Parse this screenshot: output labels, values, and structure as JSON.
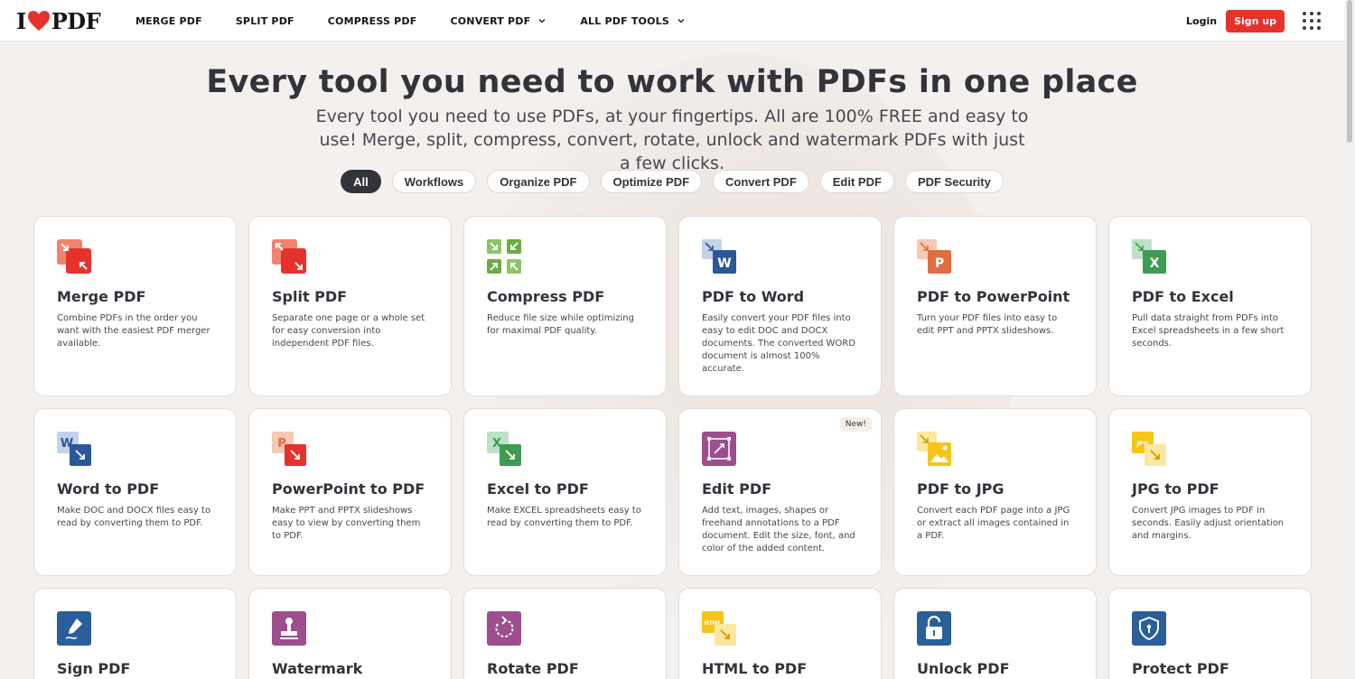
{
  "header": {
    "logo_prefix": "I",
    "logo_suffix": "PDF",
    "nav": [
      "MERGE PDF",
      "SPLIT PDF",
      "COMPRESS PDF",
      "CONVERT PDF",
      "ALL PDF TOOLS"
    ],
    "login": "Login",
    "signup": "Sign up"
  },
  "hero": {
    "title": "Every tool you need to work with PDFs in one place",
    "subtitle": "Every tool you need to use PDFs, at your fingertips. All are 100% FREE and easy to use! Merge, split, compress, convert, rotate, unlock and watermark PDFs with just a few clicks."
  },
  "filters": [
    "All",
    "Workflows",
    "Organize PDF",
    "Optimize PDF",
    "Convert PDF",
    "Edit PDF",
    "PDF Security"
  ],
  "colors": {
    "brand_red": "#e5322d",
    "organize": "#e5322d",
    "optimize": "#6bac45",
    "word": "#2b579a",
    "powerpoint": "#e06d3f",
    "excel": "#3e9b52",
    "edit": "#9c4e8e",
    "jpg": "#f5c518",
    "security": "#2b5f9a"
  },
  "tools": [
    {
      "title": "Merge PDF",
      "desc": "Combine PDFs in the order you want with the easiest PDF merger available.",
      "icon": "merge-icon"
    },
    {
      "title": "Split PDF",
      "desc": "Separate one page or a whole set for easy conversion into independent PDF files.",
      "icon": "split-icon"
    },
    {
      "title": "Compress PDF",
      "desc": "Reduce file size while optimizing for maximal PDF quality.",
      "icon": "compress-icon"
    },
    {
      "title": "PDF to Word",
      "desc": "Easily convert your PDF files into easy to edit DOC and DOCX documents. The converted WORD document is almost 100% accurate.",
      "icon": "pdf-to-word-icon",
      "letter": "W"
    },
    {
      "title": "PDF to PowerPoint",
      "desc": "Turn your PDF files into easy to edit PPT and PPTX slideshows.",
      "icon": "pdf-to-powerpoint-icon",
      "letter": "P"
    },
    {
      "title": "PDF to Excel",
      "desc": "Pull data straight from PDFs into Excel spreadsheets in a few short seconds.",
      "icon": "pdf-to-excel-icon",
      "letter": "X"
    },
    {
      "title": "Word to PDF",
      "desc": "Make DOC and DOCX files easy to read by converting them to PDF.",
      "icon": "word-to-pdf-icon",
      "letter": "W"
    },
    {
      "title": "PowerPoint to PDF",
      "desc": "Make PPT and PPTX slideshows easy to view by converting them to PDF.",
      "icon": "powerpoint-to-pdf-icon",
      "letter": "P"
    },
    {
      "title": "Excel to PDF",
      "desc": "Make EXCEL spreadsheets easy to read by converting them to PDF.",
      "icon": "excel-to-pdf-icon",
      "letter": "X"
    },
    {
      "title": "Edit PDF",
      "desc": "Add text, images, shapes or freehand annotations to a PDF document. Edit the size, font, and color of the added content.",
      "icon": "edit-icon",
      "badge": "New!"
    },
    {
      "title": "PDF to JPG",
      "desc": "Convert each PDF page into a JPG or extract all images contained in a PDF.",
      "icon": "pdf-to-jpg-icon"
    },
    {
      "title": "JPG to PDF",
      "desc": "Convert JPG images to PDF in seconds. Easily adjust orientation and margins.",
      "icon": "jpg-to-pdf-icon",
      "letter": "JPG"
    },
    {
      "title": "Sign PDF",
      "desc": "",
      "icon": "sign-icon"
    },
    {
      "title": "Watermark",
      "desc": "",
      "icon": "watermark-icon"
    },
    {
      "title": "Rotate PDF",
      "desc": "",
      "icon": "rotate-icon"
    },
    {
      "title": "HTML to PDF",
      "desc": "",
      "icon": "html-to-pdf-icon",
      "letter": "HTML"
    },
    {
      "title": "Unlock PDF",
      "desc": "",
      "icon": "unlock-icon"
    },
    {
      "title": "Protect PDF",
      "desc": "",
      "icon": "protect-icon"
    }
  ]
}
